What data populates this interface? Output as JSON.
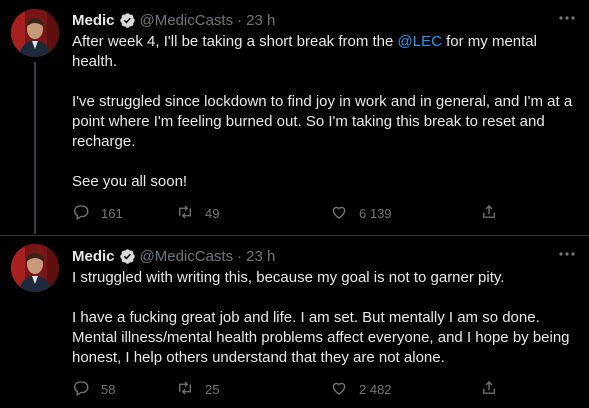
{
  "tweets": [
    {
      "name": "Medic",
      "handle": "@MedicCasts",
      "separator": "·",
      "time": "23 h",
      "text_before_link": "After week 4, I'll be taking a short break from the ",
      "link": "@LEC",
      "text_after_link": " for my mental health.",
      "paragraphs": [
        "I've struggled since lockdown to find joy in work and in general, and I'm at a point where I'm feeling burned out. So I'm taking this break to reset and recharge.",
        "See you all soon!"
      ],
      "replies": "161",
      "retweets": "49",
      "likes": "6 139"
    },
    {
      "name": "Medic",
      "handle": "@MedicCasts",
      "separator": "·",
      "time": "23 h",
      "paragraphs": [
        "I struggled with writing this, because my goal is not to garner pity.",
        "I have a fucking great job and life. I am set. But mentally I am so done. Mental illness/mental health problems affect everyone, and I hope by being honest, I help others understand that they are not alone."
      ],
      "replies": "58",
      "retweets": "25",
      "likes": "2 482"
    }
  ],
  "icons": {
    "verified": "verified-badge-icon",
    "more": "more-icon",
    "reply": "reply-icon",
    "retweet": "retweet-icon",
    "like": "heart-icon",
    "share": "share-icon"
  },
  "colors": {
    "background": "#000000",
    "text": "#e7e9ea",
    "muted": "#71767b",
    "link": "#1d9bf0",
    "avatar_bg": "#8b1a1a"
  }
}
